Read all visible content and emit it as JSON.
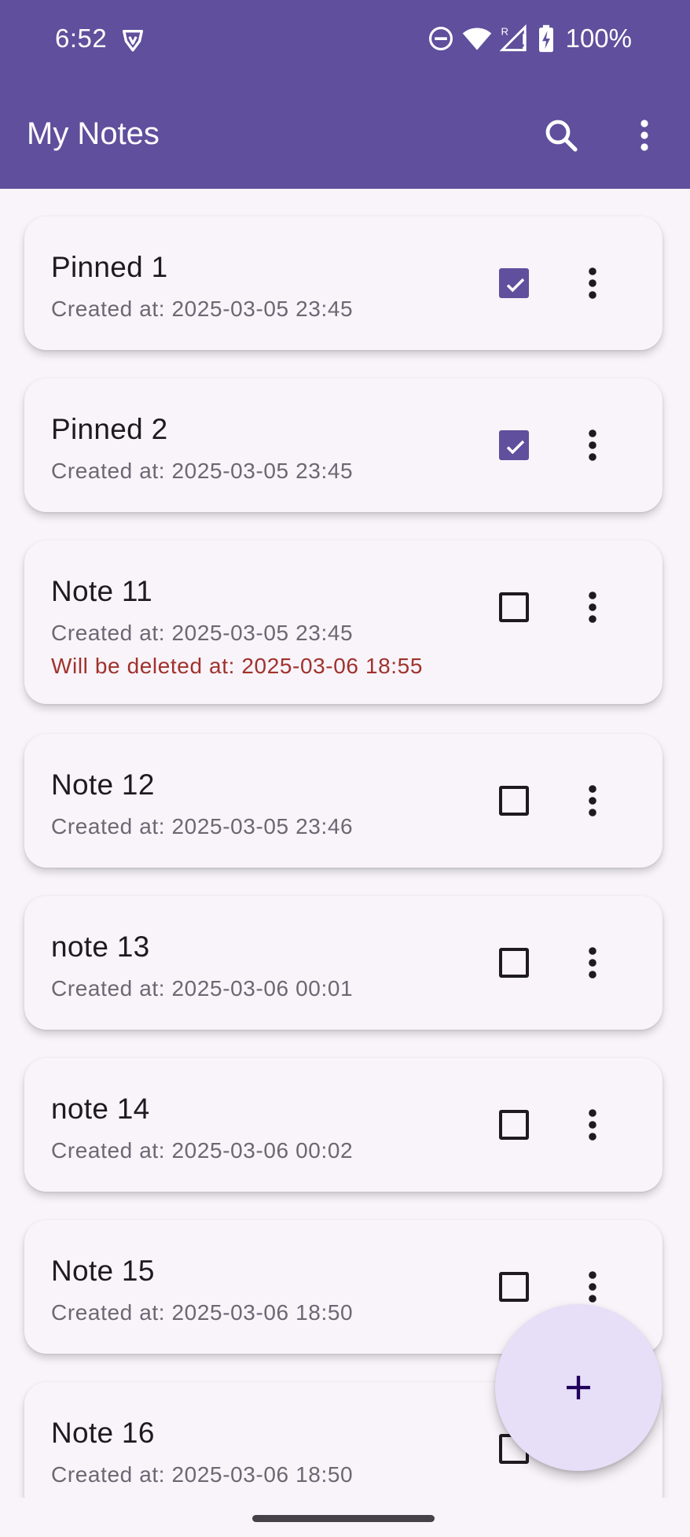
{
  "status_bar": {
    "time": "6:52",
    "battery": "100%",
    "icons": [
      "shield-icon",
      "dnd-icon",
      "wifi-icon",
      "signal-icon",
      "battery-charging-icon"
    ]
  },
  "app_bar": {
    "title": "My Notes",
    "search_icon": "search-icon",
    "more_icon": "more-vert-icon"
  },
  "notes": [
    {
      "title": "Pinned 1",
      "created": "Created at: 2025-03-05 23:45",
      "pinned": true
    },
    {
      "title": "Pinned 2",
      "created": "Created at: 2025-03-05 23:45",
      "pinned": true
    },
    {
      "title": "Note 11",
      "created": "Created at: 2025-03-05 23:45",
      "delete_at": "Will be deleted at: 2025-03-06 18:55",
      "pinned": false
    },
    {
      "title": "Note 12",
      "created": "Created at: 2025-03-05 23:46",
      "pinned": false
    },
    {
      "title": "note 13",
      "created": "Created at: 2025-03-06 00:01",
      "pinned": false
    },
    {
      "title": "note 14",
      "created": "Created at: 2025-03-06 00:02",
      "pinned": false
    },
    {
      "title": "Note 15",
      "created": "Created at: 2025-03-06 18:50",
      "pinned": false
    },
    {
      "title": "Note 16",
      "created": "Created at: 2025-03-06 18:50",
      "pinned": false
    }
  ],
  "fab": {
    "icon": "plus-icon"
  },
  "colors": {
    "primary": "#5f4f9c",
    "background": "#f8f4fa",
    "warning_text": "#a0322c",
    "fab": "#e7def8"
  }
}
